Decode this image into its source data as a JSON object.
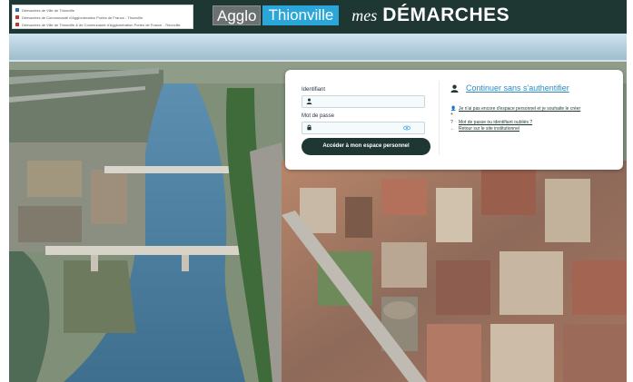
{
  "header": {
    "site_list": [
      "Démarches de Ville de Thionville",
      "Démarches de Communauté d'Agglomération Portes de France - Thionville",
      "Démarches de Ville de Thionville & de Communauté d'Agglomération Portes de France - Thionville"
    ],
    "brand_agglo": "Agglo",
    "brand_city": "Thionville",
    "service_mes": "mes",
    "service_demarches": "DÉMARCHES"
  },
  "login": {
    "identifiant_label": "Identifiant",
    "password_label": "Mot de passe",
    "submit_label": "Accéder à mon espace personnel",
    "guest_link": "Continuer sans s'authentifier",
    "create_account_link": "Je n'ai pas encore d'espace personnel et je souhaite le créer",
    "forgot_link": "Mot de passe ou identifiant oubliés ?",
    "back_link": "Retour sur le site institutionnel"
  },
  "colors": {
    "header_bg": "#1f3733",
    "brand_city_bg": "#2aa6d9",
    "link": "#2a8bc3",
    "button_bg": "#1f3733"
  },
  "icons": [
    "user-icon",
    "lock-icon",
    "eye-icon",
    "person-icon",
    "add-user-icon",
    "question-icon",
    "arrow-left-icon"
  ]
}
